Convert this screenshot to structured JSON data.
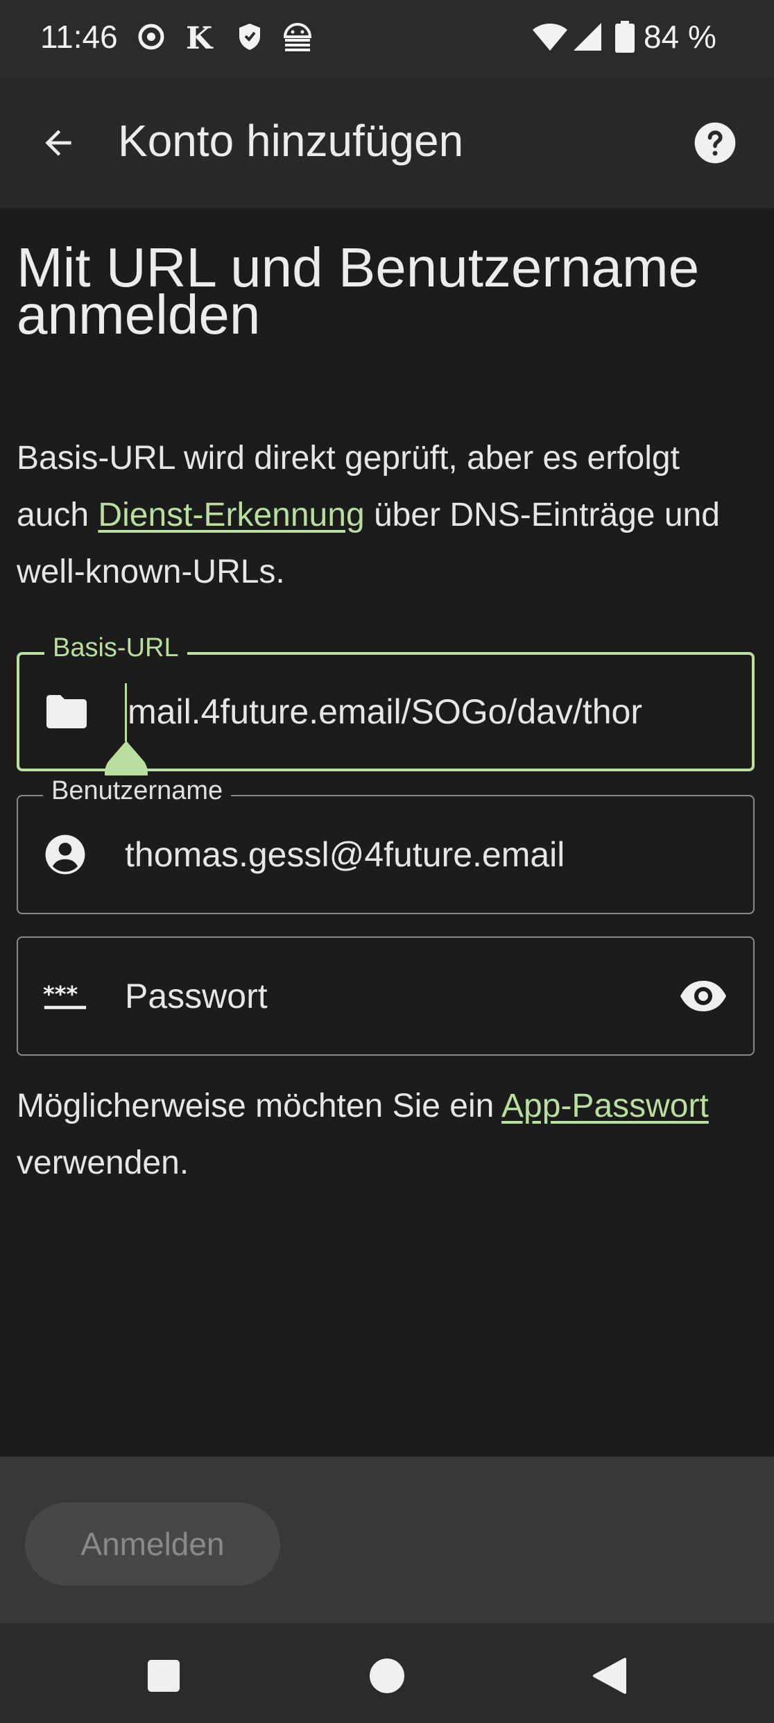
{
  "status_bar": {
    "time": "11:46",
    "battery_percent": "84 %",
    "icons": [
      "record-icon",
      "k-letter-icon",
      "shield-icon",
      "android-debug-icon",
      "wifi-icon",
      "signal-icon",
      "battery-icon"
    ]
  },
  "app_bar": {
    "title": "Konto hinzufügen",
    "back_icon": "arrow-left-icon",
    "help_icon": "help-circle-icon"
  },
  "content": {
    "heading": "Mit URL und Benutzername anmelden",
    "description_part1": "Basis-URL wird direkt geprüft, aber es erfolgt auch ",
    "description_link": "Dienst-Erkennung",
    "description_part2": " über DNS-Einträge und well-known-URLs."
  },
  "fields": {
    "base_url": {
      "label": "Basis-URL",
      "value": "mail.4future.email/SOGo/dav/thor",
      "icon": "folder-icon"
    },
    "username": {
      "label": "Benutzername",
      "value": "thomas.gessl@4future.email",
      "icon": "account-circle-icon"
    },
    "password": {
      "placeholder": "Passwort",
      "icon": "password-icon",
      "toggle_icon": "eye-icon"
    }
  },
  "hint": {
    "part1": "Möglicherweise möchten Sie ein ",
    "link": "App-Passwort",
    "part2": " verwenden."
  },
  "actions": {
    "login_label": "Anmelden"
  },
  "colors": {
    "accent": "#b9dea0",
    "background": "#1c1c1c",
    "app_bar": "#292929"
  }
}
